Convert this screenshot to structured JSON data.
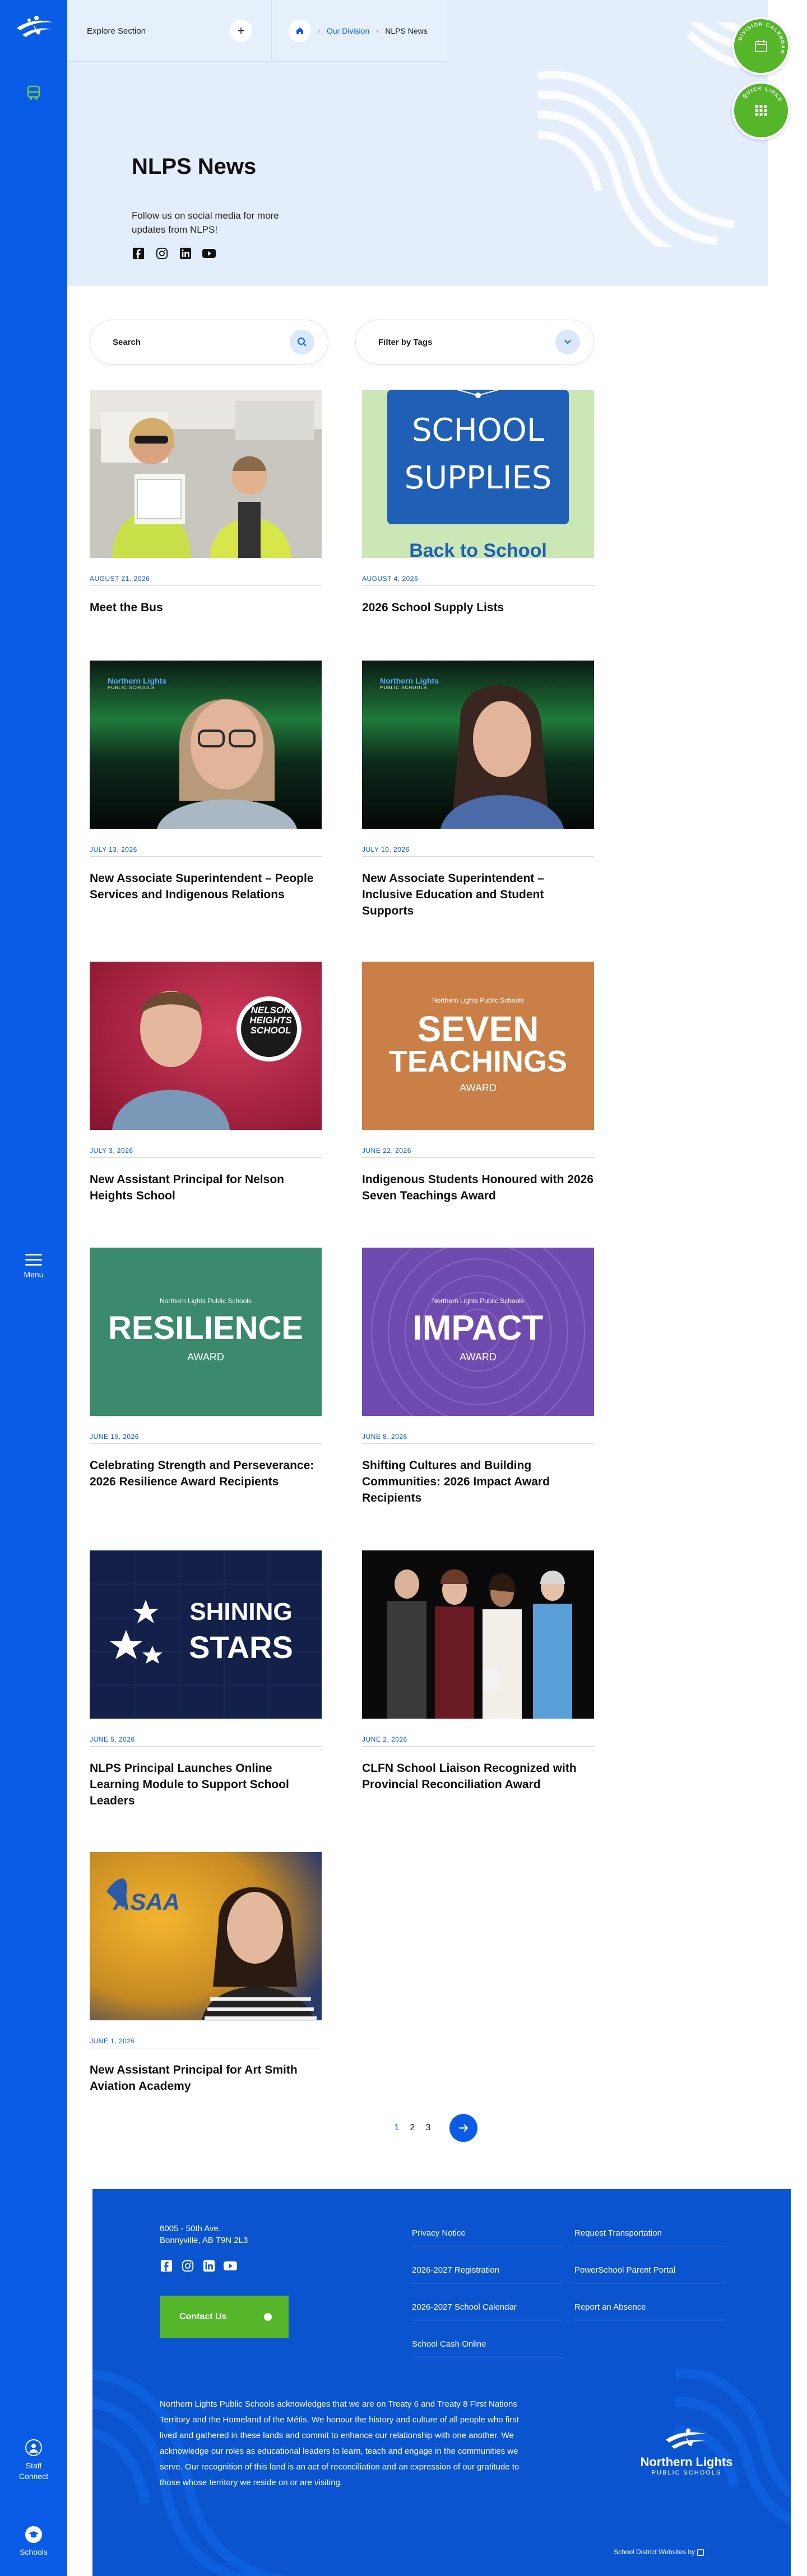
{
  "topbar": {
    "explore_label": "Explore Section",
    "breadcrumb": [
      "Our Division",
      "NLPS News"
    ]
  },
  "floating": {
    "division_calendar": "DIVISION CALENDAR",
    "quick_links": "QUICK LINKS"
  },
  "hero": {
    "title": "NLPS News",
    "subtitle": "Follow us on social media for more updates from NLPS!",
    "social_icons": [
      "facebook-icon",
      "instagram-icon",
      "linkedin-icon",
      "youtube-icon"
    ]
  },
  "filters": {
    "search_placeholder": "Search",
    "tags_label": "Filter by Tags"
  },
  "sidebar": {
    "menu_label": "Menu",
    "staff_connect": "Staff Connect",
    "schools": "Schools"
  },
  "articles": [
    {
      "date": "AUGUST 21, 2026",
      "title": "Meet the Bus"
    },
    {
      "date": "AUGUST 4, 2026",
      "title": "2026 School Supply Lists",
      "image_text": [
        "SCHOOL",
        "SUPPLIES",
        "Back to School"
      ]
    },
    {
      "date": "JULY 13, 2026",
      "title": "New Associate Superintendent – People Services and Indigenous Relations",
      "image_text": [
        "Northern Lights",
        "PUBLIC SCHOOLS"
      ]
    },
    {
      "date": "JULY 10, 2026",
      "title": "New Associate Superintendent – Inclusive Education and Student Supports",
      "image_text": [
        "Northern Lights",
        "PUBLIC SCHOOLS"
      ]
    },
    {
      "date": "JULY 3, 2026",
      "title": "New Assistant Principal for Nelson Heights School",
      "image_text": [
        "NELSON",
        "HEIGHTS",
        "SCHOOL"
      ]
    },
    {
      "date": "JUNE 22, 2026",
      "title": "Indigenous Students Honoured with 2026 Seven Teachings Award",
      "image_text": [
        "Northern Lights Public Schools",
        "SEVEN",
        "TEACHINGS",
        "AWARD"
      ]
    },
    {
      "date": "JUNE 15, 2026",
      "title": "Celebrating Strength and Perseverance: 2026 Resilience Award Recipients",
      "image_text": [
        "Northern Lights Public Schools",
        "RESILIENCE",
        "AWARD"
      ]
    },
    {
      "date": "JUNE 8, 2026",
      "title": "Shifting Cultures and Building Communities: 2026 Impact Award Recipients",
      "image_text": [
        "Northern Lights Public Schools",
        "IMPACT",
        "AWARD"
      ]
    },
    {
      "date": "JUNE 5, 2026",
      "title": "NLPS Principal Launches Online Learning Module to Support School Leaders",
      "image_text": [
        "SHINING",
        "STARS"
      ]
    },
    {
      "date": "JUNE 2, 2026",
      "title": "CLFN School Liaison Recognized with Provincial Reconciliation Award"
    },
    {
      "date": "JUNE 1, 2026",
      "title": "New Assistant Principal for Art Smith Aviation Academy",
      "image_text": [
        "ASAA"
      ]
    }
  ],
  "pagination": {
    "pages": [
      "1",
      "2",
      "3"
    ],
    "current": "1"
  },
  "footer": {
    "address_line1": "6005 - 50th Ave.",
    "address_line2": "Bonnyville, AB T9N 2L3",
    "contact_label": "Contact Us",
    "links": [
      "Privacy Notice",
      "Request Transportation",
      "2026-2027 Registration",
      "PowerSchool Parent Portal",
      "2026-2027 School Calendar",
      "Report an Absence",
      "School Cash Online"
    ],
    "acknowledgement": "Northern Lights Public Schools acknowledges that we are on Treaty 6 and Treaty 8 First Nations Territory and the Homeland of the Métis. We honour the history and culture of all people who first lived and gathered in these lands and commit to enhance our relationship with one another. We acknowledge our roles as educational leaders to learn, teach and engage in the communities we serve. Our recognition of this land is an act of reconciliation and an expression of our gratitude to those whose territory we reside on or are visiting.",
    "logo_line1": "Northern Lights",
    "logo_line2": "PUBLIC SCHOOLS",
    "credit": "School District Websites by"
  },
  "colors": {
    "brand_blue": "#0a5ce6",
    "footer_blue": "#0a54d0",
    "accent_green": "#55b62a",
    "hero_bg": "#e4eefb"
  }
}
